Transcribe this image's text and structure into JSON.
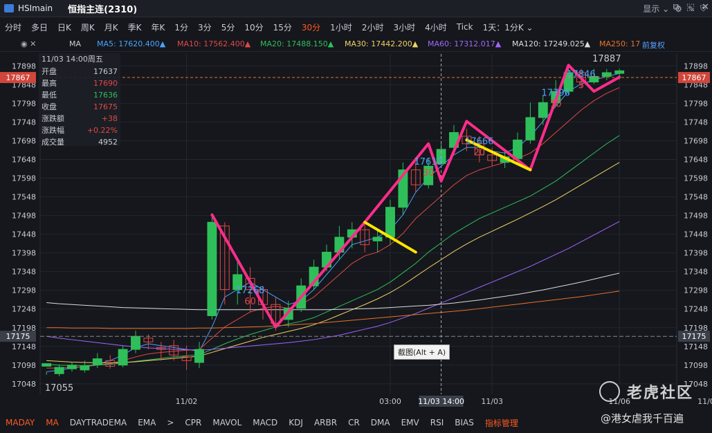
{
  "window": {
    "app_name": "HSImain",
    "symbol_title": "恒指主连(2310)",
    "buttons": [
      "⧉",
      "⬚",
      "✕"
    ]
  },
  "timeframes": {
    "items": [
      "分时",
      "多日",
      "日K",
      "周K",
      "月K",
      "季K",
      "年K",
      "1分",
      "3分",
      "5分",
      "10分",
      "15分",
      "30分",
      "1小时",
      "2小时",
      "3小时",
      "4小时",
      "Tick",
      "1天：1分K ⌄"
    ],
    "active_index": 12,
    "display_label": "显示 ⌄"
  },
  "ma_bar": {
    "type_label": "MA",
    "items": [
      {
        "label": "MA5: 17620.400▲",
        "color": "#4aa3ff"
      },
      {
        "label": "MA10: 17562.400▲",
        "color": "#e04848"
      },
      {
        "label": "MA20: 17488.150▲",
        "color": "#2fbf5a"
      },
      {
        "label": "MA30: 17442.200▲",
        "color": "#f0d264"
      },
      {
        "label": "MA60: 17312.017▲",
        "color": "#a066ff"
      },
      {
        "label": "MA120: 17249.025▲",
        "color": "#dddddd"
      },
      {
        "label": "MA250: 17",
        "color": "#e8732a"
      }
    ],
    "adjust_label": "前复权"
  },
  "ohlc_box": {
    "datetime": "11/03 14:00周五",
    "rows": [
      {
        "label": "开盘",
        "value": "17637",
        "color": "#c8ccd4"
      },
      {
        "label": "最高",
        "value": "17690",
        "color": "#e04848"
      },
      {
        "label": "最低",
        "value": "17636",
        "color": "#2fbf5a"
      },
      {
        "label": "收盘",
        "value": "17675",
        "color": "#e04848"
      },
      {
        "label": "涨跌额",
        "value": "+38",
        "color": "#e04848"
      },
      {
        "label": "涨跌幅",
        "value": "+0.22%",
        "color": "#e04848"
      },
      {
        "label": "成交量",
        "value": "4952",
        "color": "#c8ccd4"
      }
    ]
  },
  "tooltip": "截图(Alt + A)",
  "bottom": {
    "indicators": [
      "MADAY",
      "MA",
      "DAYTRADEMA",
      "EMA",
      ">",
      "CPR",
      "MAVOL",
      "MACD",
      "KDJ",
      "ARBR",
      "CR",
      "DMA",
      "EMV",
      "RSI",
      "BIAS",
      "指标管理"
    ],
    "highlight": [
      0,
      1,
      15
    ]
  },
  "watermark": {
    "text": "老虎社区",
    "handle": "@港女虐我千百遍"
  },
  "chart_data": {
    "type": "candlestick",
    "ylim": [
      17020,
      17930
    ],
    "y_ticks": [
      17898,
      17848,
      17798,
      17748,
      17698,
      17648,
      17598,
      17548,
      17498,
      17448,
      17398,
      17348,
      17298,
      17248,
      17198,
      17148,
      17098,
      17048
    ],
    "right_ticks": [
      17898,
      17848,
      17798,
      17748,
      17698,
      17648,
      17598,
      17548,
      17498,
      17448,
      17398,
      17348,
      17298,
      17248,
      17198,
      17148,
      17098,
      17048
    ],
    "current_price": "17867",
    "right_current": "17867",
    "ref_price": "17175",
    "x_labels": [
      {
        "i": 11,
        "label": "11/02"
      },
      {
        "i": 27,
        "label": "03:00"
      },
      {
        "i": 31,
        "label": "11/03 14:00",
        "highlight": true
      },
      {
        "i": 35,
        "label": "11/03"
      },
      {
        "i": 45,
        "label": "11/06"
      },
      {
        "i": 52,
        "label": "11/06"
      }
    ],
    "crosshair_index": 31,
    "candles": [
      [
        17095,
        17102,
        17080,
        17072
      ],
      [
        17075,
        17092,
        17100,
        17068
      ],
      [
        17088,
        17098,
        17105,
        17080
      ],
      [
        17085,
        17095,
        17110,
        17078
      ],
      [
        17100,
        17115,
        17130,
        17090
      ],
      [
        17110,
        17095,
        17125,
        17088
      ],
      [
        17098,
        17140,
        17150,
        17092
      ],
      [
        17140,
        17175,
        17190,
        17130
      ],
      [
        17170,
        17160,
        17180,
        17140
      ],
      [
        17145,
        17140,
        17160,
        17110
      ],
      [
        17150,
        17125,
        17165,
        17110
      ],
      [
        17120,
        17110,
        17150,
        17085
      ],
      [
        17105,
        17140,
        17160,
        17090
      ],
      [
        17230,
        17480,
        17500,
        17220
      ],
      [
        17470,
        17300,
        17480,
        17260
      ],
      [
        17300,
        17340,
        17380,
        17260
      ],
      [
        17330,
        17300,
        17360,
        17240
      ],
      [
        17300,
        17260,
        17310,
        17220
      ],
      [
        17260,
        17210,
        17280,
        17190
      ],
      [
        17220,
        17250,
        17270,
        17200
      ],
      [
        17250,
        17310,
        17330,
        17240
      ],
      [
        17310,
        17360,
        17380,
        17300
      ],
      [
        17360,
        17400,
        17420,
        17350
      ],
      [
        17400,
        17440,
        17470,
        17380
      ],
      [
        17440,
        17460,
        17480,
        17410
      ],
      [
        17460,
        17420,
        17480,
        17400
      ],
      [
        17430,
        17440,
        17460,
        17400
      ],
      [
        17440,
        17520,
        17540,
        17420
      ],
      [
        17520,
        17620,
        17640,
        17500
      ],
      [
        17620,
        17580,
        17640,
        17560
      ],
      [
        17580,
        17630,
        17650,
        17570
      ],
      [
        17637,
        17675,
        17690,
        17636
      ],
      [
        17680,
        17720,
        17740,
        17660
      ],
      [
        17710,
        17690,
        17730,
        17670
      ],
      [
        17690,
        17660,
        17710,
        17640
      ],
      [
        17660,
        17645,
        17680,
        17630
      ],
      [
        17640,
        17655,
        17670,
        17625
      ],
      [
        17650,
        17700,
        17720,
        17640
      ],
      [
        17700,
        17760,
        17800,
        17690
      ],
      [
        17760,
        17800,
        17820,
        17740
      ],
      [
        17800,
        17830,
        17860,
        17790
      ],
      [
        17830,
        17880,
        17896,
        17820
      ],
      [
        17880,
        17855,
        17890,
        17840
      ],
      [
        17855,
        17870,
        17890,
        17850
      ],
      [
        17870,
        17880,
        17890,
        17860
      ],
      [
        17878,
        17885,
        17890,
        17862
      ]
    ],
    "ma_lines": [
      {
        "name": "MA5",
        "color": "#4aa3ff",
        "values": [
          17080,
          17085,
          17090,
          17095,
          17100,
          17110,
          17125,
          17145,
          17155,
          17150,
          17145,
          17140,
          17135,
          17200,
          17280,
          17300,
          17320,
          17300,
          17280,
          17260,
          17270,
          17300,
          17340,
          17380,
          17420,
          17430,
          17440,
          17460,
          17500,
          17560,
          17600,
          17630,
          17660,
          17680,
          17680,
          17670,
          17665,
          17680,
          17710,
          17750,
          17790,
          17830,
          17850,
          17860,
          17870,
          17878
        ]
      },
      {
        "name": "MA10",
        "color": "#e04848",
        "values": [
          17090,
          17090,
          17092,
          17094,
          17098,
          17102,
          17110,
          17120,
          17128,
          17132,
          17135,
          17138,
          17140,
          17170,
          17200,
          17220,
          17240,
          17250,
          17255,
          17250,
          17260,
          17280,
          17310,
          17340,
          17370,
          17390,
          17400,
          17420,
          17450,
          17490,
          17520,
          17550,
          17580,
          17605,
          17620,
          17630,
          17640,
          17650,
          17665,
          17690,
          17720,
          17750,
          17780,
          17805,
          17825,
          17840
        ]
      },
      {
        "name": "MA20",
        "color": "#2fbf5a",
        "values": [
          17100,
          17098,
          17097,
          17097,
          17098,
          17100,
          17104,
          17108,
          17112,
          17116,
          17120,
          17123,
          17126,
          17140,
          17155,
          17168,
          17180,
          17190,
          17200,
          17208,
          17215,
          17225,
          17240,
          17255,
          17270,
          17285,
          17300,
          17320,
          17345,
          17370,
          17400,
          17425,
          17450,
          17470,
          17490,
          17505,
          17520,
          17535,
          17550,
          17570,
          17590,
          17615,
          17640,
          17665,
          17690,
          17712
        ]
      },
      {
        "name": "MA30",
        "color": "#f0d264",
        "values": [
          17110,
          17108,
          17106,
          17105,
          17104,
          17104,
          17105,
          17107,
          17110,
          17113,
          17116,
          17119,
          17122,
          17132,
          17142,
          17152,
          17162,
          17172,
          17180,
          17188,
          17196,
          17206,
          17218,
          17232,
          17246,
          17260,
          17275,
          17292,
          17312,
          17335,
          17358,
          17380,
          17402,
          17422,
          17440,
          17456,
          17472,
          17488,
          17505,
          17522,
          17540,
          17560,
          17580,
          17600,
          17620,
          17640
        ]
      },
      {
        "name": "MA60",
        "color": "#a066ff",
        "values": [
          17175,
          17170,
          17166,
          17162,
          17158,
          17154,
          17150,
          17147,
          17144,
          17142,
          17140,
          17139,
          17138,
          17140,
          17143,
          17146,
          17149,
          17152,
          17155,
          17158,
          17162,
          17166,
          17172,
          17178,
          17186,
          17194,
          17202,
          17212,
          17224,
          17236,
          17250,
          17264,
          17278,
          17292,
          17306,
          17320,
          17334,
          17348,
          17362,
          17378,
          17394,
          17410,
          17428,
          17446,
          17464,
          17482
        ]
      },
      {
        "name": "MA120",
        "color": "#dddddd",
        "values": [
          17265,
          17262,
          17260,
          17258,
          17256,
          17254,
          17252,
          17251,
          17250,
          17249,
          17248,
          17247,
          17246,
          17246,
          17246,
          17246,
          17246,
          17246,
          17246,
          17246,
          17246,
          17246,
          17246,
          17247,
          17248,
          17249,
          17250,
          17252,
          17254,
          17256,
          17258,
          17261,
          17264,
          17268,
          17272,
          17277,
          17282,
          17287,
          17293,
          17299,
          17306,
          17313,
          17320,
          17328,
          17336,
          17344
        ]
      },
      {
        "name": "MA250",
        "color": "#e8732a",
        "values": [
          17198,
          17198,
          17197,
          17197,
          17197,
          17196,
          17196,
          17196,
          17196,
          17196,
          17196,
          17196,
          17197,
          17197,
          17198,
          17199,
          17200,
          17201,
          17203,
          17205,
          17207,
          17209,
          17212,
          17215,
          17218,
          17221,
          17224,
          17227,
          17230,
          17233,
          17236,
          17239,
          17242,
          17245,
          17249,
          17253,
          17257,
          17261,
          17265,
          17269,
          17273,
          17277,
          17281,
          17286,
          17291,
          17296
        ]
      }
    ],
    "annotations_pink": [
      [
        13,
        17500
      ],
      [
        18,
        17200
      ],
      [
        25,
        17480
      ],
      [
        30,
        17690
      ],
      [
        31,
        17590
      ],
      [
        33,
        17750
      ],
      [
        38,
        17620
      ],
      [
        41,
        17900
      ],
      [
        43,
        17830
      ],
      [
        45,
        17868
      ]
    ],
    "annotations_yellow": [
      [
        [
          25,
          17480
        ],
        [
          29,
          17400
        ]
      ],
      [
        [
          33,
          17700
        ],
        [
          38,
          17620
        ]
      ]
    ],
    "annotation_labels": [
      {
        "i": 16,
        "y": 17268,
        "text": "17268",
        "color": "#4aa3ff",
        "dy": -12
      },
      {
        "i": 16,
        "y": 17268,
        "text": "60",
        "color": "#e04848",
        "dy": 4
      },
      {
        "i": 30,
        "y": 17612,
        "text": "17612",
        "color": "#4aa3ff",
        "dy": -12
      },
      {
        "i": 30,
        "y": 17612,
        "text": "30",
        "color": "#e04848",
        "dy": 4
      },
      {
        "i": 34,
        "y": 17666,
        "text": "17666",
        "color": "#4aa3ff",
        "dy": -12
      },
      {
        "i": 34,
        "y": 17666,
        "text": "20",
        "color": "#e04848",
        "dy": 4
      },
      {
        "i": 40,
        "y": 17796,
        "text": "17796",
        "color": "#4aa3ff",
        "dy": -12
      },
      {
        "i": 40,
        "y": 17796,
        "text": "10",
        "color": "#e04848",
        "dy": 4
      },
      {
        "i": 42,
        "y": 17846,
        "text": "17846",
        "color": "#4aa3ff",
        "dy": -12
      },
      {
        "i": 42,
        "y": 17846,
        "text": "5",
        "color": "#e04848",
        "dy": 4
      },
      {
        "i": 44,
        "y": 17887,
        "text": "17887",
        "color": "#c8ccd4",
        "dy": -12
      },
      {
        "i": 1,
        "y": 17055,
        "text": "17055",
        "color": "#c8ccd4",
        "dy": 14
      }
    ]
  }
}
